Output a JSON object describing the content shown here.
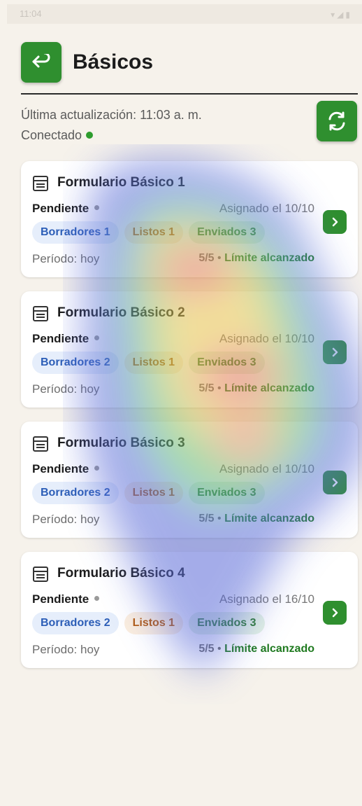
{
  "status_bar": {
    "time": "11:04",
    "right": "▾◢▮"
  },
  "header": {
    "title": "Básicos"
  },
  "meta": {
    "last_update": "Última actualización: 11:03 a. m.",
    "connection": "Conectado"
  },
  "cards": [
    {
      "title": "Formulario Básico 1",
      "status": "Pendiente",
      "assigned": "Asignado el 10/10",
      "chips": {
        "drafts": "Borradores 1",
        "ready": "Listos 1",
        "sent": "Enviados 3"
      },
      "period": "Período: hoy",
      "limit_count": "5/5",
      "limit_sep": " • ",
      "limit_text": "Límite alcanzado"
    },
    {
      "title": "Formulario Básico 2",
      "status": "Pendiente",
      "assigned": "Asignado el 10/10",
      "chips": {
        "drafts": "Borradores 2",
        "ready": "Listos 1",
        "sent": "Enviados 3"
      },
      "period": "Período: hoy",
      "limit_count": "5/5",
      "limit_sep": " • ",
      "limit_text": "Límite alcanzado"
    },
    {
      "title": "Formulario Básico 3",
      "status": "Pendiente",
      "assigned": "Asignado el 10/10",
      "chips": {
        "drafts": "Borradores 2",
        "ready": "Listos 1",
        "sent": "Enviados 3"
      },
      "period": "Período: hoy",
      "limit_count": "5/5",
      "limit_sep": " • ",
      "limit_text": "Límite alcanzado"
    },
    {
      "title": "Formulario Básico 4",
      "status": "Pendiente",
      "assigned": "Asignado el 16/10",
      "chips": {
        "drafts": "Borradores 2",
        "ready": "Listos 1",
        "sent": "Enviados 3"
      },
      "period": "Período: hoy",
      "limit_count": "5/5",
      "limit_sep": " • ",
      "limit_text": "Límite alcanzado"
    }
  ],
  "colors": {
    "accent": "#2f8f2f",
    "background": "#f6f2eb",
    "connected": "#2e9c2e"
  },
  "icons": {
    "back": "back-arrow-icon",
    "refresh": "refresh-icon",
    "form": "form-icon",
    "go": "chevron-right-icon"
  }
}
